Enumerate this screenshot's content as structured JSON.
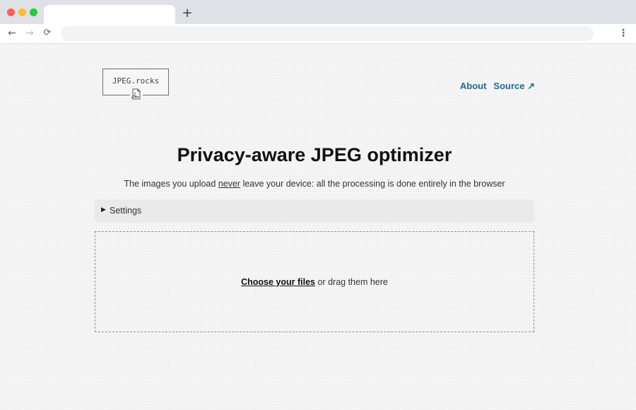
{
  "browser": {
    "new_tab_label": "+",
    "back_label": "←",
    "forward_label": "→",
    "reload_label": "⟳",
    "menu_label": "⋮"
  },
  "site": {
    "logo_text": "JPEG.rocks",
    "logo_icon": "image-file-icon"
  },
  "nav": {
    "about": "About",
    "source": "Source ↗"
  },
  "main": {
    "title": "Privacy-aware JPEG optimizer",
    "subtitle_before": "The images you upload ",
    "subtitle_emphasis": "never",
    "subtitle_after": " leave your device: all the processing is done entirely in the browser",
    "settings_label": "Settings",
    "settings_arrow": "▶",
    "dropzone": {
      "link_text": "Choose your files",
      "rest_text": " or drag them here"
    }
  },
  "colors": {
    "link": "#1f6c93",
    "page_bg": "#f6f6f6",
    "settings_bg": "#eaeaea",
    "dropzone_border": "#8d93a0"
  }
}
